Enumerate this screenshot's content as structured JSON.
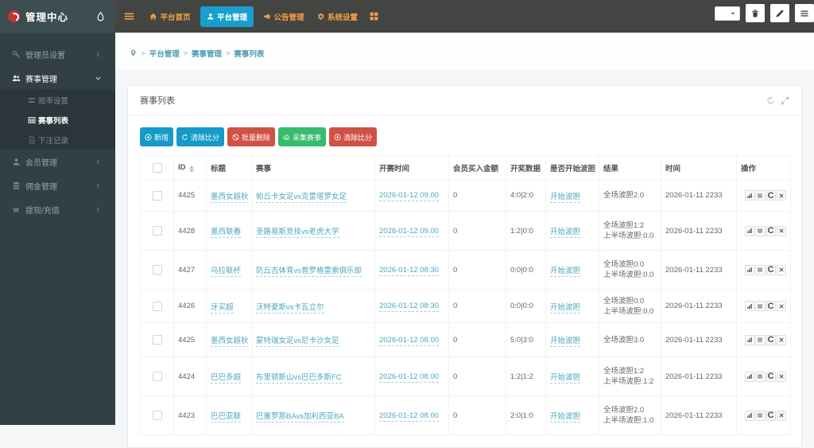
{
  "topbar": {
    "brand": "管理中心",
    "nav": [
      {
        "label": "平台首页",
        "icon": "home",
        "active": false
      },
      {
        "label": "平台管理",
        "icon": "user",
        "active": true
      },
      {
        "label": "公告管理",
        "icon": "announce",
        "active": false
      },
      {
        "label": "系统设置",
        "icon": "gear",
        "active": false
      }
    ]
  },
  "sidebar": {
    "items": [
      {
        "label": "管理员设置",
        "icon": "key",
        "chevron": "left",
        "active": false
      },
      {
        "label": "赛事管理",
        "icon": "users",
        "chevron": "down",
        "active": true,
        "children": [
          {
            "label": "赔率设置",
            "icon": "th",
            "active": false
          },
          {
            "label": "赛事列表",
            "icon": "table",
            "active": true
          },
          {
            "label": "下注记录",
            "icon": "file",
            "active": false
          }
        ]
      },
      {
        "label": "会员管理",
        "icon": "person",
        "chevron": "left",
        "active": false
      },
      {
        "label": "佣金管理",
        "icon": "database",
        "chevron": "left",
        "active": false
      },
      {
        "label": "提现/充值",
        "icon": "won",
        "chevron": "left",
        "active": false
      }
    ]
  },
  "breadcrumb": [
    "平台管理",
    "赛事管理",
    "赛事列表"
  ],
  "panel": {
    "title": "赛事列表",
    "toolbar": [
      {
        "label": "新增",
        "icon": "plus",
        "color": "blue"
      },
      {
        "label": "清除比分",
        "icon": "refresh",
        "color": "blue"
      },
      {
        "label": "批量删除",
        "icon": "ban",
        "color": "red"
      },
      {
        "label": "采集赛事",
        "icon": "cloud",
        "color": "green"
      },
      {
        "label": "清除比分",
        "icon": "circleo",
        "color": "red"
      }
    ],
    "table": {
      "headers": [
        "ID",
        "标题",
        "赛事",
        "开赛时间",
        "会员买入金额",
        "开奖数据",
        "是否开始波胆",
        "结果",
        "时间",
        "操作"
      ],
      "rows": [
        {
          "id": "4425",
          "title": "墨西女超秋",
          "match": "帕丘卡女足vs克雷塔罗女足",
          "start": "2026-01-12 09.00",
          "amount": "0",
          "score": "4:0|2:0",
          "action": "开始波胆",
          "result": [
            "全场波胆2.0"
          ],
          "time": "2026-01-11 2233"
        },
        {
          "id": "4428",
          "title": "墨西联春",
          "match": "圣路易斯竞技vs老虎大学",
          "start": "2026-01-12 09.00",
          "amount": "0",
          "score": "1:2|0:0",
          "action": "开始波胆",
          "result": [
            "全场波胆1:2",
            "上半场波胆:0.0"
          ],
          "time": "2026-01-11 2233"
        },
        {
          "id": "4427",
          "title": "乌拉联杯",
          "match": "防丘吉体育vs普罗格雷索俱乐部",
          "start": "2026-01-12 08:30",
          "amount": "0",
          "score": "0:0|0:0",
          "action": "开始波胆",
          "result": [
            "全场波胆0.0",
            "上半场波胆:0.0"
          ],
          "time": "2026-01-11 2233"
        },
        {
          "id": "4426",
          "title": "牙买超",
          "match": "沃特豪斯vs卡瓦立尔",
          "start": "2026-01-12 08:30",
          "amount": "0",
          "score": "0:0|0:0",
          "action": "开始波胆",
          "result": [
            "全场波胆0.0",
            "上半场波胆:0.0"
          ],
          "time": "2026-01-11 2233"
        },
        {
          "id": "4425",
          "title": "墨西女超秋",
          "match": "蒙特瑞女足vs尼卡沙女足",
          "start": "2026-01-12 08.00",
          "amount": "0",
          "score": "5:0|3:0",
          "action": "开始波胆",
          "result": [
            "全场波胆3.0"
          ],
          "time": "2026-01-11 2233"
        },
        {
          "id": "4424",
          "title": "巴巴多超",
          "match": "布里顿斯山vs巴巴多斯FC",
          "start": "2026-01-12 08.00",
          "amount": "0",
          "score": "1:2|1:2",
          "action": "开始波胆",
          "result": [
            "全场波胆1:2",
            "上半场波胆:1:2"
          ],
          "time": "2026-01-11 2233"
        },
        {
          "id": "4423",
          "title": "巴巴亚联",
          "match": "巴塞罗那BAvs加利西亚BA",
          "start": "2026-01-12 08.00",
          "amount": "0",
          "score": "2:0|1:0",
          "action": "开始波胆",
          "result": [
            "全场波胆2.0",
            "上半场波胆:1.0"
          ],
          "time": "2026-01-11 2233"
        }
      ]
    }
  }
}
